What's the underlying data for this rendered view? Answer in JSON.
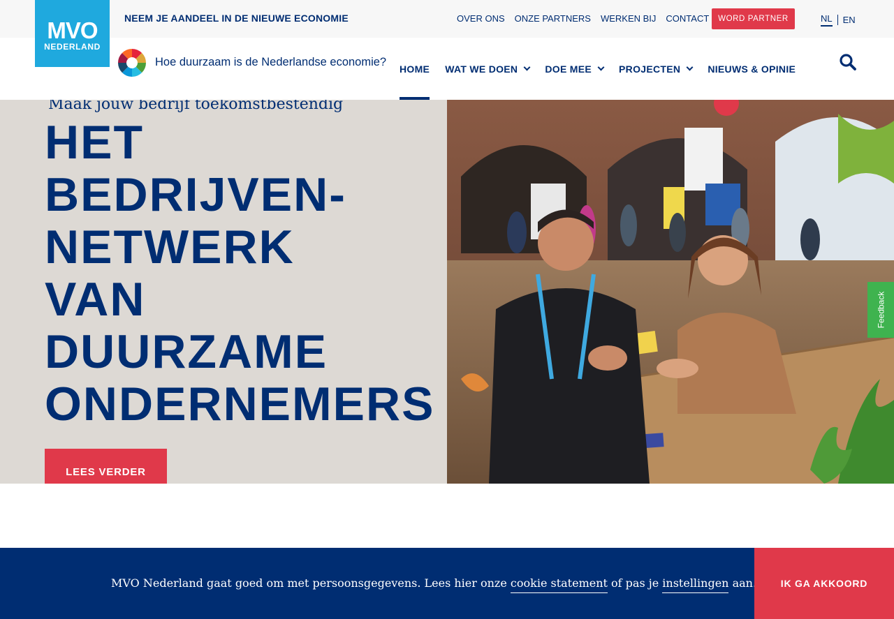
{
  "header": {
    "logo_top": "MVO",
    "logo_bottom": "NEDERLAND",
    "tagline": "NEEM JE AANDEEL IN DE NIEUWE ECONOMIE",
    "top_links": [
      "OVER ONS",
      "ONZE PARTNERS",
      "WERKEN BIJ",
      "CONTACT"
    ],
    "partner_button": "WORD PARTNER",
    "languages": [
      "NL",
      "EN"
    ],
    "active_language": "NL"
  },
  "nav": {
    "economy_link": "Hoe duurzaam is de Nederlandse economie?",
    "items": [
      {
        "label": "HOME",
        "dropdown": false,
        "active": true
      },
      {
        "label": "WAT WE DOEN",
        "dropdown": true,
        "active": false
      },
      {
        "label": "DOE MEE",
        "dropdown": true,
        "active": false
      },
      {
        "label": "PROJECTEN",
        "dropdown": true,
        "active": false
      },
      {
        "label": "NIEUWS & OPINIE",
        "dropdown": false,
        "active": false
      }
    ],
    "search_icon": "search-icon"
  },
  "hero": {
    "kicker": "Maak jouw bedrijf toekomstbestendig",
    "headline_lines": [
      "HET",
      "BEDRIJVEN-",
      "NETWERK",
      "VAN",
      "DUURZAME",
      "ONDERNEMERS"
    ],
    "cta": "LEES VERDER",
    "image": "photo-networking-event"
  },
  "feedback_tab": "Feedback",
  "cookie": {
    "text_before": "MVO Nederland gaat goed om met persoonsgegevens. Lees hier onze ",
    "link_statement": "cookie statement",
    "text_middle": " of pas je ",
    "link_settings": "instellingen",
    "text_after": " aan.",
    "accept_button": "IK GA AKKOORD"
  },
  "colors": {
    "navy": "#002d72",
    "red": "#e0394a",
    "logo_blue": "#1fa9de",
    "hero_bg": "#ddd9d4",
    "feedback_green": "#3fb34f"
  }
}
